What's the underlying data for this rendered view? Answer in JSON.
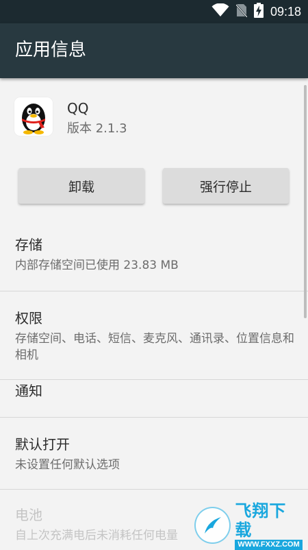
{
  "status_bar": {
    "time": "09:18",
    "icons": [
      "wifi-icon",
      "no-sim-icon",
      "battery-charging-icon"
    ]
  },
  "app_bar": {
    "title": "应用信息"
  },
  "app": {
    "name": "QQ",
    "version": "版本 2.1.3",
    "icon": "qq-penguin-icon"
  },
  "buttons": {
    "uninstall": "卸载",
    "force_stop": "强行停止"
  },
  "sections": [
    {
      "title": "存储",
      "subtitle": "内部存储空间已使用 23.83 MB"
    },
    {
      "title": "权限",
      "subtitle": "存储空间、电话、短信、麦克风、通讯录、位置信息和相机"
    },
    {
      "title": "通知",
      "subtitle": ""
    },
    {
      "title": "默认打开",
      "subtitle": "未设置任何默认选项"
    },
    {
      "title": "电池",
      "subtitle": "自上次充满电后未消耗任何电量"
    }
  ],
  "watermark": {
    "brand": "飞翔下载",
    "url": "WWW.FXXZ.COM"
  },
  "colors": {
    "status_bar": "#1c2a30",
    "app_bar": "#283940",
    "background": "#f3f3f3",
    "button": "#dcdcdc",
    "watermark": "#19a7de"
  }
}
